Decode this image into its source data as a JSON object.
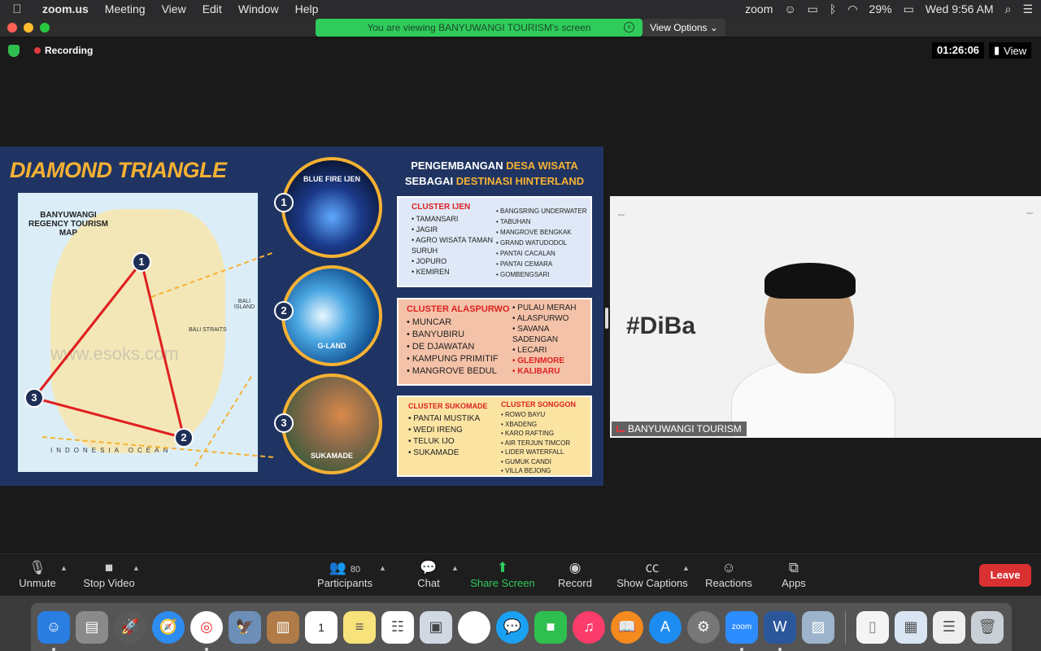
{
  "menubar": {
    "app": "zoom.us",
    "items": [
      "Meeting",
      "View",
      "Edit",
      "Window",
      "Help"
    ],
    "zoom_label": "zoom",
    "battery": "29%",
    "clock": "Wed 9:56 AM"
  },
  "banner": {
    "viewing": "You are viewing BANYUWANGI TOURISM's screen",
    "view_options": "View Options"
  },
  "meeting": {
    "recording": "Recording",
    "timer": "01:26:06",
    "view": "View"
  },
  "slide": {
    "title": "DIAMOND TRIANGLE",
    "map_title": "BANYUWANGI REGENCY TOURISM MAP",
    "map_watermark": "www.esoks.com",
    "bali_island": "BALI ISLAND",
    "bali_strait": "BALI STRAITS",
    "ocean": "INDONESIA OCEAN",
    "badges": [
      "1",
      "2",
      "3"
    ],
    "destinations": [
      {
        "label": "BLUE FIRE IJEN",
        "num": "1"
      },
      {
        "label": "G-LAND",
        "num": "2"
      },
      {
        "label": "SUKAMADE",
        "num": "3"
      }
    ],
    "right_title_line1_a": "PENGEMBANGAN ",
    "right_title_line1_b": "DESA WISATA",
    "right_title_line2_a": "SEBAGAI ",
    "right_title_line2_b": "DESTINASI HINTERLAND",
    "cluster_ijen": {
      "head": "CLUSTER IJEN",
      "left": [
        "TAMANSARI",
        "JAGIR",
        "AGRO WISATA TAMAN SURUH",
        "JOPURO",
        "KEMIREN"
      ],
      "right": [
        "BANGSRING UNDERWATER",
        "TABUHAN",
        "MANGROVE BENGKAK",
        "GRAND WATUDODOL",
        "PANTAI CACALAN",
        "PANTAI CEMARA",
        "GOMBENGSARI"
      ]
    },
    "cluster_alaspurwo": {
      "head": "CLUSTER ALASPURWO",
      "left": [
        "MUNCAR",
        "BANYUBIRU",
        "DE DJAWATAN",
        "KAMPUNG PRIMITIF",
        "MANGROVE BEDUL"
      ],
      "right": [
        "PULAU MERAH",
        "ALASPURWO",
        "SAVANA SADENGAN",
        "LECARI"
      ],
      "right_red": [
        "GLENMORE",
        "KALIBARU"
      ]
    },
    "cluster_sukomade": {
      "head": "CLUSTER SUKOMADE",
      "left": [
        "PANTAI MUSTIKA",
        "WEDI IRENG",
        "TELUK IJO",
        "SUKAMADE"
      ]
    },
    "cluster_songgon": {
      "head": "CLUSTER SONGGON",
      "right": [
        "ROWO BAYU",
        "XBADENG",
        "KARO RAFTING",
        "AIR TERJUN TIMCOR",
        "LIDER WATERFALL",
        "GUMUK CANDI",
        "VILLA BEJONG"
      ]
    }
  },
  "video": {
    "tag": "#DiBa          ngiAja",
    "name": "BANYUWANGI TOURISM"
  },
  "toolbar": {
    "unmute": "Unmute",
    "stop_video": "Stop Video",
    "participants_count": "80",
    "participants": "Participants",
    "chat": "Chat",
    "share_screen": "Share Screen",
    "record": "Record",
    "captions": "Show Captions",
    "reactions": "Reactions",
    "apps": "Apps",
    "leave": "Leave"
  },
  "colors": {
    "accent_green": "#2fcc5c",
    "leave_red": "#d93032",
    "slide_gold": "#f6b133",
    "slide_navy": "#1f3462"
  }
}
